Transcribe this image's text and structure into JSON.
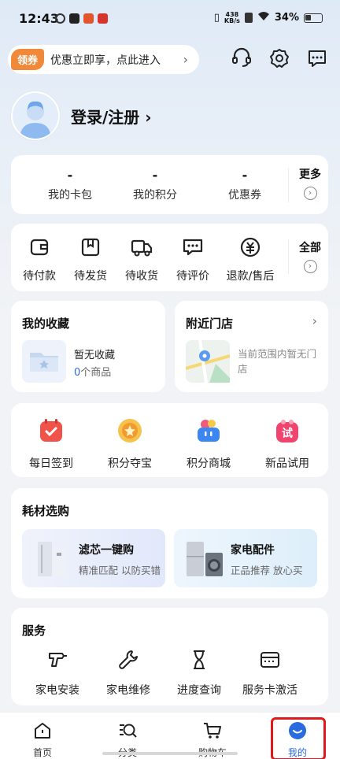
{
  "status_bar": {
    "time": "12:43",
    "net_speed": "438",
    "net_unit": "KB/s",
    "battery": "34%"
  },
  "promo": {
    "badge": "领券",
    "text": "优惠立即享，点此进入",
    "arrow": "›"
  },
  "header_icons": [
    "headset-icon",
    "gear-icon",
    "message-icon"
  ],
  "profile": {
    "login_text": "登录/注册 ›"
  },
  "stats": {
    "items": [
      {
        "value": "-",
        "label": "我的卡包"
      },
      {
        "value": "-",
        "label": "我的积分"
      },
      {
        "value": "-",
        "label": "优惠券"
      }
    ],
    "more": "更多"
  },
  "orders": {
    "items": [
      {
        "label": "待付款",
        "icon": "wallet-icon"
      },
      {
        "label": "待发货",
        "icon": "package-icon"
      },
      {
        "label": "待收货",
        "icon": "truck-icon"
      },
      {
        "label": "待评价",
        "icon": "comment-icon"
      },
      {
        "label": "退款/售后",
        "icon": "refund-icon"
      }
    ],
    "all": "全部"
  },
  "favorites": {
    "title": "我的收藏",
    "empty": "暂无收藏",
    "count": "0",
    "count_suffix": "个商品"
  },
  "stores": {
    "title": "附近门店",
    "empty": "当前范围内暂无门店"
  },
  "features": [
    {
      "label": "每日签到",
      "icon": "calendar-check-icon",
      "color": "#f0534a"
    },
    {
      "label": "积分夺宝",
      "icon": "coin-star-icon",
      "color": "#f4b63a"
    },
    {
      "label": "积分商城",
      "icon": "basket-icon",
      "color": "#3b86f0"
    },
    {
      "label": "新品试用",
      "icon": "trial-tag-icon",
      "color": "#f0436e"
    }
  ],
  "consumables": {
    "title": "耗材选购",
    "cards": [
      {
        "name": "滤芯一键购",
        "sub": "精准匹配 以防买错"
      },
      {
        "name": "家电配件",
        "sub": "正品推荐 放心买"
      }
    ]
  },
  "service": {
    "title": "服务",
    "items": [
      {
        "label": "家电安装",
        "icon": "drill-icon"
      },
      {
        "label": "家电维修",
        "icon": "wrench-icon"
      },
      {
        "label": "进度查询",
        "icon": "hourglass-icon"
      },
      {
        "label": "服务卡激活",
        "icon": "card-icon"
      }
    ]
  },
  "tabs": [
    {
      "label": "首页",
      "icon": "home-icon"
    },
    {
      "label": "分类",
      "icon": "category-search-icon"
    },
    {
      "label": "购物车",
      "icon": "cart-icon"
    },
    {
      "label": "我的",
      "icon": "profile-face-icon",
      "active": true
    }
  ],
  "accent": "#2a6be0"
}
